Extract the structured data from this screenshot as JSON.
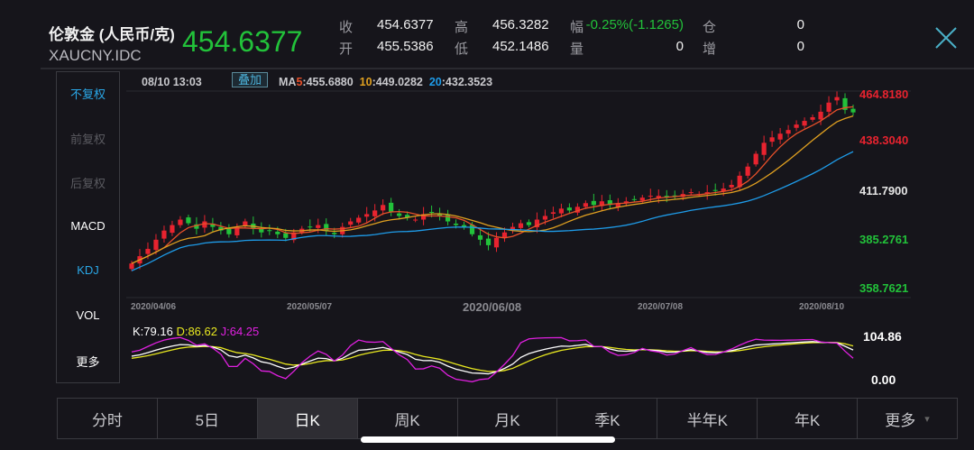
{
  "header": {
    "name": "伦敦金 (人民币/克)",
    "code": "XAUCNY.IDC",
    "price": "454.6377",
    "quotes": [
      {
        "label": "收",
        "value": "454.6377"
      },
      {
        "label": "高",
        "value": "456.3282"
      },
      {
        "label": "幅",
        "value": "-0.25%(-1.1265)"
      },
      {
        "label": "仓",
        "value": "0"
      },
      {
        "label": "开",
        "value": "455.5386"
      },
      {
        "label": "低",
        "value": "452.1486"
      },
      {
        "label": "量",
        "value": "0"
      },
      {
        "label": "增",
        "value": "0"
      }
    ]
  },
  "sidebar": [
    "不复权",
    "前复权",
    "后复权",
    "MACD",
    "KDJ",
    "VOL",
    "更多"
  ],
  "info": {
    "time": "08/10 13:03",
    "overlay": "叠加",
    "ma5_label": "MA",
    "ma5_num": "5",
    "ma5": ":455.6880",
    "ma10_num": "10",
    "ma10": ":449.0282",
    "ma20_num": "20",
    "ma20": ":432.3523"
  },
  "kdj": {
    "k": "K:79.16",
    "d": "D:86.62",
    "j": "J:64.25",
    "top": "104.86",
    "bottom": "0.00"
  },
  "colors": {
    "up": "#e8232f",
    "down": "#22c23a",
    "ma5": "#e8502a",
    "ma10": "#e0a020",
    "ma20": "#1e9be8",
    "k": "#ffffff",
    "d": "#e8e820",
    "j": "#e020e0"
  },
  "tabs": [
    "分时",
    "5日",
    "日K",
    "周K",
    "月K",
    "季K",
    "半年K",
    "年K",
    "更多"
  ],
  "chart_data": {
    "type": "candlestick",
    "y_ticks": [
      "464.8180",
      "438.3040",
      "411.7900",
      "385.2761",
      "358.7621"
    ],
    "ylim": [
      358.7621,
      464.818
    ],
    "x_ticks": [
      "2020/04/06",
      "2020/05/07",
      "2020/06/08",
      "2020/07/08",
      "2020/08/10"
    ],
    "closes": [
      372,
      376,
      380,
      385,
      390,
      393,
      396,
      394,
      391,
      395,
      392,
      390,
      388,
      392,
      395,
      391,
      389,
      390,
      388,
      386,
      389,
      391,
      392,
      393,
      390,
      388,
      392,
      395,
      397,
      399,
      401,
      404,
      400,
      398,
      397,
      396,
      399,
      400,
      398,
      395,
      393,
      392,
      388,
      385,
      382,
      386,
      389,
      392,
      394,
      393,
      396,
      398,
      400,
      402,
      401,
      403,
      405,
      404,
      406,
      404,
      405,
      406,
      407,
      408,
      409,
      409,
      408,
      409,
      410,
      411,
      410,
      411,
      412,
      413,
      415,
      420,
      425,
      432,
      438,
      441,
      443,
      445,
      448,
      450,
      452,
      455,
      460,
      463,
      456,
      454.6377
    ]
  }
}
